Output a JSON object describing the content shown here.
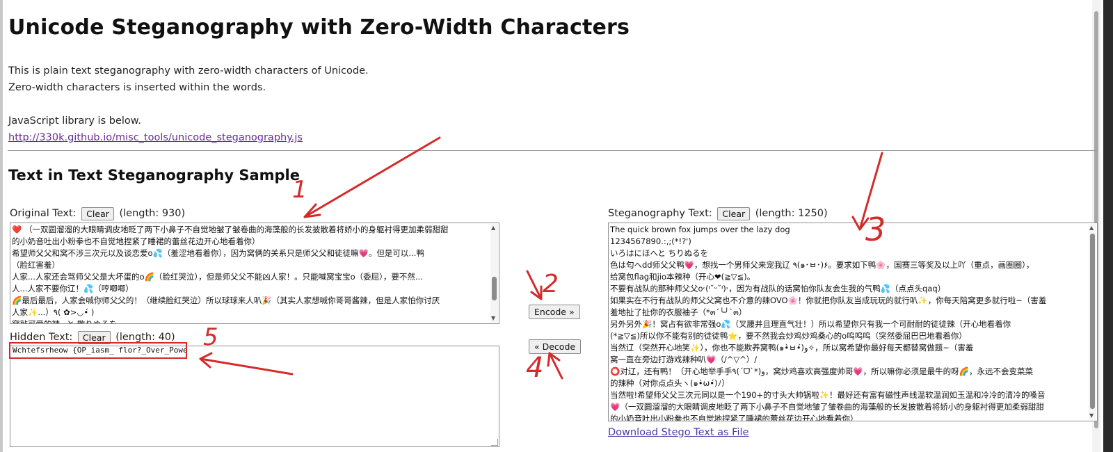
{
  "page": {
    "title": "Unicode Steganography with Zero-Width Characters",
    "intro_lines": [
      "This is plain text steganography with zero-width characters of Unicode.",
      "Zero-width characters is inserted within the words.",
      "",
      "JavaScript library is below."
    ],
    "library_link": "http://330k.github.io/misc_tools/unicode_steganography.js",
    "section_title": "Text in Text Steganography Sample"
  },
  "original": {
    "label": "Original Text:",
    "clear_label": "Clear",
    "length_text": "(length: 930)",
    "lines": [
      "❤️ （一双圆溜溜的大眼睛调皮地眨了两下小鼻子不自觉地皱了皱卷曲的海藻般的长发披散着将娇小的身躯衬得更加柔弱甜甜",
      "的小奶音吐出小粉拳也不自觉地捏紧了睡裙的蕾丝花边开心地看着你）",
      "希望师父父和窝不涉三次元以及谈恋爱o💦（羞涩地看着你），因为窝俩的关系只是师父父和徒徒嘛💗。但是可以...鸭",
      "（脸红害羞）",
      "人家...人家还会骂师父父是大坏蛋的o🌈（脸红哭泣），但是师父父不能凶人家！。只能喊窝宝宝o（委屈），要不然...",
      "人...人家不要你辽！💦（哼唧唧）",
      "🌈最后最后，人家会喊你师父父的！（继续脸红哭泣）所以球球来人叭🎉（其实人家想喊你哥哥酱辣，但是人家怕你讨厌",
      "人家✨...）٩( ✿>◡•́ )",
      "窝敲可爱的辣~と 散りぬるを"
    ]
  },
  "hidden": {
    "label": "Hidden Text:",
    "clear_label": "Clear",
    "length_text": "(length: 40)",
    "value": "Wchtefsrheow {OP_iasm_ flor?_Over_Power}"
  },
  "actions": {
    "encode_label": "Encode »",
    "decode_label": "« Decode"
  },
  "stego": {
    "label": "Steganography Text:",
    "clear_label": "Clear",
    "length_text": "(length: 1250)",
    "lines": [
      "The quick brown fox jumps over the lazy dog",
      "1234567890.:,;(*!?')",
      "いろはにほへと ちりぬるを",
      "色は匂へdd师父父鸭💗，想找一个男师父来宠我辽 ٩(๑･ㅂ･)۶。要求如下鸭🌸，国赛三等奖及以上吖（重点，画圈圈），",
      "给窝包flag和jio本辣种（开心❤(≧▽≦)。",
      "不要有战队的那种师父父o˓(ᑊ˘ᵕ˘ᑊ)˒，因为有战队的话窝怕你队友会生我的气鸭💦（点点头qaq）",
      "如果实在不行有战队的师父父窝也不介意的辣OVO🌸！你就把你队友当成玩玩的就行叭✨，你每天陪窝更多就行啦~（害羞",
      "羞地扯了扯你的衣服袖子（*๓´╰╯`๓）",
      "另外另外🎉！窝占有欲非常强o💦（叉腰并且理直气壮！）所以希望你只有我一个可耐耐的徒徒辣（开心地看着你",
      "(*≧▽≦)所以你不能有别的徒徒鸭⭐，要不然我会炒鸡炒鸡桑心的o呜呜呜（突然委屈巴巴地看着你）",
      "当然辽（突然开心地笑✨），你也不能欺养窝鸭(๑•̀ㅂ•́)و✧，所以窝希望你最好每天都替窝做题~（害羞",
      "窝一直在旁边打游戏辣种叭💗（/^▽^）/",
      "⭕对辽，还有鸭！（开心地举手手٩(ˊᗜˋ*)و，窝炒鸡喜欢高强度帅哥💗，所以嘛你必须是最牛的呀🌈，永远不会变菜菜",
      "的辣种（对你点点头ヽ(๑•̀ω•́)ﾉ）",
      "当然啦!希望师父父三次元同以是一个190+的寸头大帅锅啦✨！最好还有富有磁性声线温软温润如玉温和冷冷的清冷的嗓音",
      "💗（一双圆溜溜的大眼睛调皮地眨了两下小鼻子不自觉地皱了皱卷曲的海藻般的长发披散着将娇小的身躯衬得更加柔弱甜甜",
      "的小奶音吐出小粉拳也不自觉地捏紧了睡裙的蕾丝花边开心地看着你）"
    ],
    "download_label": "Download Stego Text as File"
  },
  "annotations": {
    "labels": [
      "1",
      "2",
      "3",
      "4",
      "5"
    ],
    "color": "#d42a2a"
  }
}
